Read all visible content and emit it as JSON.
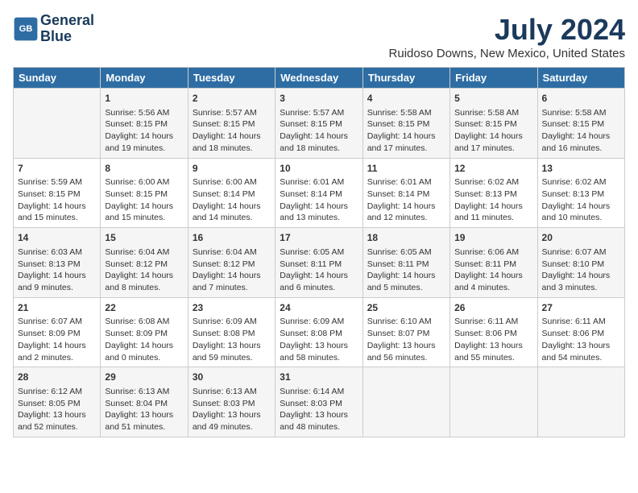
{
  "header": {
    "logo_line1": "General",
    "logo_line2": "Blue",
    "month_title": "July 2024",
    "location": "Ruidoso Downs, New Mexico, United States"
  },
  "columns": [
    "Sunday",
    "Monday",
    "Tuesday",
    "Wednesday",
    "Thursday",
    "Friday",
    "Saturday"
  ],
  "rows": [
    [
      {
        "day": "",
        "content": ""
      },
      {
        "day": "1",
        "content": "Sunrise: 5:56 AM\nSunset: 8:15 PM\nDaylight: 14 hours and 19 minutes."
      },
      {
        "day": "2",
        "content": "Sunrise: 5:57 AM\nSunset: 8:15 PM\nDaylight: 14 hours and 18 minutes."
      },
      {
        "day": "3",
        "content": "Sunrise: 5:57 AM\nSunset: 8:15 PM\nDaylight: 14 hours and 18 minutes."
      },
      {
        "day": "4",
        "content": "Sunrise: 5:58 AM\nSunset: 8:15 PM\nDaylight: 14 hours and 17 minutes."
      },
      {
        "day": "5",
        "content": "Sunrise: 5:58 AM\nSunset: 8:15 PM\nDaylight: 14 hours and 17 minutes."
      },
      {
        "day": "6",
        "content": "Sunrise: 5:58 AM\nSunset: 8:15 PM\nDaylight: 14 hours and 16 minutes."
      }
    ],
    [
      {
        "day": "7",
        "content": "Sunrise: 5:59 AM\nSunset: 8:15 PM\nDaylight: 14 hours and 15 minutes."
      },
      {
        "day": "8",
        "content": "Sunrise: 6:00 AM\nSunset: 8:15 PM\nDaylight: 14 hours and 15 minutes."
      },
      {
        "day": "9",
        "content": "Sunrise: 6:00 AM\nSunset: 8:14 PM\nDaylight: 14 hours and 14 minutes."
      },
      {
        "day": "10",
        "content": "Sunrise: 6:01 AM\nSunset: 8:14 PM\nDaylight: 14 hours and 13 minutes."
      },
      {
        "day": "11",
        "content": "Sunrise: 6:01 AM\nSunset: 8:14 PM\nDaylight: 14 hours and 12 minutes."
      },
      {
        "day": "12",
        "content": "Sunrise: 6:02 AM\nSunset: 8:13 PM\nDaylight: 14 hours and 11 minutes."
      },
      {
        "day": "13",
        "content": "Sunrise: 6:02 AM\nSunset: 8:13 PM\nDaylight: 14 hours and 10 minutes."
      }
    ],
    [
      {
        "day": "14",
        "content": "Sunrise: 6:03 AM\nSunset: 8:13 PM\nDaylight: 14 hours and 9 minutes."
      },
      {
        "day": "15",
        "content": "Sunrise: 6:04 AM\nSunset: 8:12 PM\nDaylight: 14 hours and 8 minutes."
      },
      {
        "day": "16",
        "content": "Sunrise: 6:04 AM\nSunset: 8:12 PM\nDaylight: 14 hours and 7 minutes."
      },
      {
        "day": "17",
        "content": "Sunrise: 6:05 AM\nSunset: 8:11 PM\nDaylight: 14 hours and 6 minutes."
      },
      {
        "day": "18",
        "content": "Sunrise: 6:05 AM\nSunset: 8:11 PM\nDaylight: 14 hours and 5 minutes."
      },
      {
        "day": "19",
        "content": "Sunrise: 6:06 AM\nSunset: 8:11 PM\nDaylight: 14 hours and 4 minutes."
      },
      {
        "day": "20",
        "content": "Sunrise: 6:07 AM\nSunset: 8:10 PM\nDaylight: 14 hours and 3 minutes."
      }
    ],
    [
      {
        "day": "21",
        "content": "Sunrise: 6:07 AM\nSunset: 8:09 PM\nDaylight: 14 hours and 2 minutes."
      },
      {
        "day": "22",
        "content": "Sunrise: 6:08 AM\nSunset: 8:09 PM\nDaylight: 14 hours and 0 minutes."
      },
      {
        "day": "23",
        "content": "Sunrise: 6:09 AM\nSunset: 8:08 PM\nDaylight: 13 hours and 59 minutes."
      },
      {
        "day": "24",
        "content": "Sunrise: 6:09 AM\nSunset: 8:08 PM\nDaylight: 13 hours and 58 minutes."
      },
      {
        "day": "25",
        "content": "Sunrise: 6:10 AM\nSunset: 8:07 PM\nDaylight: 13 hours and 56 minutes."
      },
      {
        "day": "26",
        "content": "Sunrise: 6:11 AM\nSunset: 8:06 PM\nDaylight: 13 hours and 55 minutes."
      },
      {
        "day": "27",
        "content": "Sunrise: 6:11 AM\nSunset: 8:06 PM\nDaylight: 13 hours and 54 minutes."
      }
    ],
    [
      {
        "day": "28",
        "content": "Sunrise: 6:12 AM\nSunset: 8:05 PM\nDaylight: 13 hours and 52 minutes."
      },
      {
        "day": "29",
        "content": "Sunrise: 6:13 AM\nSunset: 8:04 PM\nDaylight: 13 hours and 51 minutes."
      },
      {
        "day": "30",
        "content": "Sunrise: 6:13 AM\nSunset: 8:03 PM\nDaylight: 13 hours and 49 minutes."
      },
      {
        "day": "31",
        "content": "Sunrise: 6:14 AM\nSunset: 8:03 PM\nDaylight: 13 hours and 48 minutes."
      },
      {
        "day": "",
        "content": ""
      },
      {
        "day": "",
        "content": ""
      },
      {
        "day": "",
        "content": ""
      }
    ]
  ]
}
